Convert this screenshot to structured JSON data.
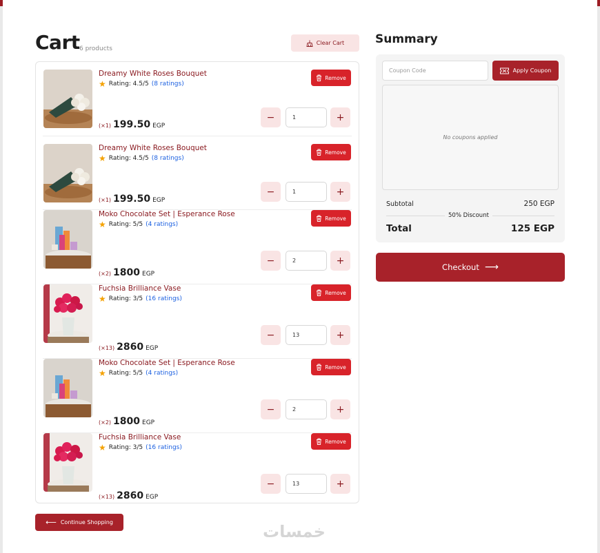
{
  "cart": {
    "title": "Cart",
    "count_label": "6 products",
    "clear_label": "Clear Cart",
    "continue_label": "Continue Shopping",
    "items": [
      {
        "name": "Dreamy White Roses Bouquet",
        "rating_label": "Rating: 4.5/5",
        "ratings_count": "(8 ratings)",
        "qty_prefix": "(×1)",
        "price": "199.50",
        "currency": "EGP",
        "quantity": "1",
        "remove_label": "Remove",
        "image": "white-roses-bouquet"
      },
      {
        "name": "Dreamy White Roses Bouquet",
        "rating_label": "Rating: 4.5/5",
        "ratings_count": "(8 ratings)",
        "qty_prefix": "(×1)",
        "price": "199.50",
        "currency": "EGP",
        "quantity": "1",
        "remove_label": "Remove",
        "image": "white-roses-bouquet"
      },
      {
        "name": "Moko Chocolate Set | Esperance Rose",
        "rating_label": "Rating: 5/5",
        "ratings_count": "(4 ratings)",
        "qty_prefix": "(×2)",
        "price": "1800",
        "currency": "EGP",
        "quantity": "2",
        "remove_label": "Remove",
        "image": "chocolate-set"
      },
      {
        "name": "Fuchsia Brilliance Vase",
        "rating_label": "Rating: 3/5",
        "ratings_count": "(16 ratings)",
        "qty_prefix": "(×13)",
        "price": "2860",
        "currency": "EGP",
        "quantity": "13",
        "remove_label": "Remove",
        "image": "fuchsia-vase"
      },
      {
        "name": "Moko Chocolate Set | Esperance Rose",
        "rating_label": "Rating: 5/5",
        "ratings_count": "(4 ratings)",
        "qty_prefix": "(×2)",
        "price": "1800",
        "currency": "EGP",
        "quantity": "2",
        "remove_label": "Remove",
        "image": "chocolate-set"
      },
      {
        "name": "Fuchsia Brilliance Vase",
        "rating_label": "Rating: 3/5",
        "ratings_count": "(16 ratings)",
        "qty_prefix": "(×13)",
        "price": "2860",
        "currency": "EGP",
        "quantity": "13",
        "remove_label": "Remove",
        "image": "fuchsia-vase"
      }
    ]
  },
  "summary": {
    "title": "Summary",
    "coupon_placeholder": "Coupon Code",
    "apply_label": "Apply Coupon",
    "no_coupons": "No coupons applied",
    "subtotal_label": "Subtotal",
    "subtotal_value": "250 EGP",
    "discount_label": "50% Discount",
    "total_label": "Total",
    "total_value": "125 EGP",
    "checkout_label": "Checkout"
  },
  "watermark": "خمسات",
  "colors": {
    "brand": "#a8222a",
    "remove": "#d8232a",
    "link": "#1a5fe0",
    "star": "#f4a100",
    "soft": "#f9e4e4"
  }
}
